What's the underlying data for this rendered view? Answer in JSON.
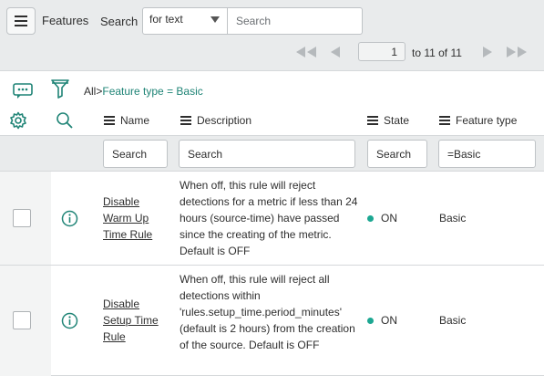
{
  "header": {
    "title": "Features",
    "search_label": "Search",
    "search_field": "for text",
    "search_placeholder": "Search"
  },
  "pagination": {
    "current_page": "1",
    "range_text": "to 11 of 11"
  },
  "breadcrumb": {
    "all": "All",
    "separator": ">",
    "filter": "Feature type = Basic"
  },
  "columns": {
    "name": "Name",
    "description": "Description",
    "state": "State",
    "feature_type": "Feature type"
  },
  "filters": {
    "name": "Search",
    "description": "Search",
    "state": "Search",
    "feature_type": "=Basic"
  },
  "rows": [
    {
      "name": "Disable Warm Up Time Rule",
      "description": "When off, this rule will reject detections for a metric if less than 24 hours (source-time) have passed since the creating of the metric. Default is OFF",
      "state": "ON",
      "feature_type": "Basic"
    },
    {
      "name": "Disable Setup Time Rule",
      "description": "When off, this rule will reject all detections within 'rules.setup_time.period_minutes' (default is 2 hours) from the creation of the source. Default is OFF",
      "state": "ON",
      "feature_type": "Basic"
    }
  ],
  "colors": {
    "accent": "#1f8476",
    "state_on": "#1ca792",
    "toolbar_bg": "#e9ebec"
  },
  "icons": {
    "menu": "hamburger-icon",
    "first": "double-chevron-left-icon",
    "prev": "chevron-left-icon",
    "next": "chevron-right-icon",
    "last": "double-chevron-right-icon",
    "chat": "chat-bubble-icon",
    "filter": "funnel-icon",
    "settings": "gear-icon",
    "search": "magnifier-icon",
    "info": "info-circle-icon"
  }
}
